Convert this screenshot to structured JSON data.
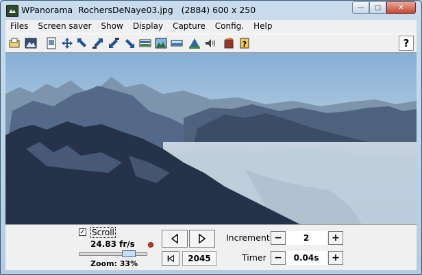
{
  "window": {
    "title": "WPanorama  RochersDeNaye03.jpg   (2884) 600 x 250",
    "buttons": {
      "minimize": "—",
      "maximize": "□",
      "close": "✕"
    }
  },
  "menu": [
    "Files",
    "Screen saver",
    "Show",
    "Display",
    "Capture",
    "Config.",
    "Help"
  ],
  "toolbar": {
    "icons": [
      "open-file-icon",
      "picture-icon",
      "page-icon",
      "move-icon",
      "arrow-up-left-icon",
      "arrow-out-icon",
      "arrow-in-icon",
      "arrow-down-right-icon",
      "panorama-icon",
      "panorama-color-icon",
      "panorama-strip-icon",
      "mountain-icon",
      "speaker-icon",
      "book-icon",
      "help-book-icon"
    ],
    "help_label": "?"
  },
  "controls": {
    "scroll_checked": "✓",
    "scroll_label": "Scroll",
    "fps": "24.83 fr/s",
    "zoom_label": "Zoom: 33%",
    "zoom_level": 0.33,
    "position": "2045",
    "increment_label": "Increment",
    "increment_value": "2",
    "timer_label": "Timer",
    "timer_value": "0.04s",
    "minus": "−",
    "plus": "+"
  },
  "colors": {
    "sky": "#8fb5d6",
    "mountain_dark": "#22304a",
    "cloud": "#c9d6e2"
  }
}
